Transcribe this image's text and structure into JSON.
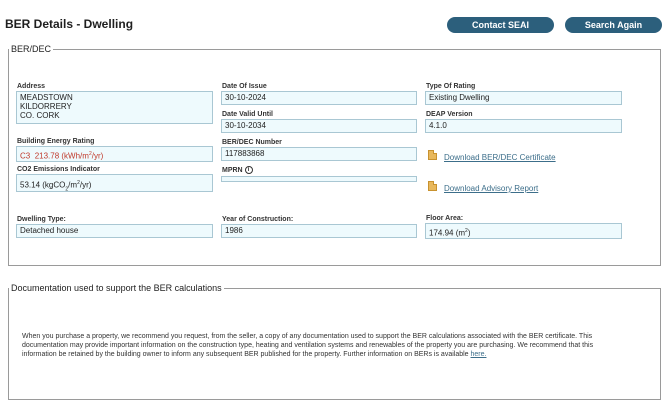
{
  "header": {
    "title": "BER Details - Dwelling",
    "contact_button": "Contact SEAI",
    "search_again_button": "Search Again"
  },
  "ber_dec": {
    "legend": "BER/DEC",
    "address_label": "Address",
    "address_lines": [
      "MEADSTOWN",
      "KILDORRERY",
      "CO. CORK"
    ],
    "date_of_issue_label": "Date Of Issue",
    "date_of_issue": "30-10-2024",
    "date_valid_until_label": "Date Valid Until",
    "date_valid_until": "30-10-2034",
    "type_of_rating_label": "Type Of Rating",
    "type_of_rating": "Existing Dwelling",
    "deap_version_label": "DEAP Version",
    "deap_version": "4.1.0",
    "ber_label": "Building Energy Rating",
    "ber_grade": "C3",
    "ber_value": "213.78",
    "ber_unit_pre": "(kWh/m",
    "ber_unit_sup": "2",
    "ber_unit_post": "/yr)",
    "ber_dec_number_label": "BER/DEC Number",
    "ber_dec_number": "117883868",
    "download_certificate": "Download BER/DEC Certificate",
    "co2_label": "CO2 Emissions Indicator",
    "co2_value": "53.14",
    "co2_unit_pre": "(kgCO",
    "co2_unit_sub": "2",
    "co2_unit_mid": "/m",
    "co2_unit_sup": "2",
    "co2_unit_post": "/yr)",
    "mprn_label": "MPRN",
    "mprn_value": "",
    "download_advisory": "Download Advisory Report",
    "dwelling_type_label": "Dwelling Type:",
    "dwelling_type": "Detached house",
    "year_label": "Year of Construction:",
    "year": "1986",
    "floor_area_label": "Floor Area:",
    "floor_area_value": "174.94",
    "floor_area_unit_pre": "(m",
    "floor_area_unit_sup": "2",
    "floor_area_unit_post": ")"
  },
  "documentation": {
    "legend": "Documentation used to support the BER calculations",
    "paragraph": "When you purchase a property, we recommend you request, from the seller, a copy of any documentation used to support the BER calculations associated with the BER certificate. This documentation may provide important information on the construction type, heating and ventilation systems and renewables of the property you are purchasing. We recommend that this information be retained by the building owner to inform any subsequent BER published for the property. Further information on BERs is available",
    "link_text": "here."
  }
}
